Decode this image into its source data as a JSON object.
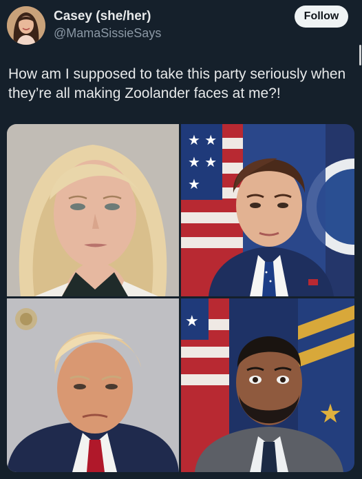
{
  "author": {
    "display_name": "Casey (she/her)",
    "handle": "@MamaSissieSays"
  },
  "follow_button": {
    "label": "Follow"
  },
  "tweet": {
    "text": "How am I supposed to take this party seriously when they’re all making Zoolander faces at me?!"
  },
  "media": {
    "images": [
      {
        "description_icon": "portrait-photo-blonde-woman"
      },
      {
        "description_icon": "portrait-photo-man-flags"
      },
      {
        "description_icon": "mugshot-photo-man"
      },
      {
        "description_icon": "portrait-photo-bearded-man-flags"
      }
    ]
  },
  "colors": {
    "background": "#15202b",
    "text_primary": "#e7e9ea",
    "text_secondary": "#8b98a5",
    "follow_bg": "#eff3f4",
    "follow_text": "#0f1419"
  }
}
